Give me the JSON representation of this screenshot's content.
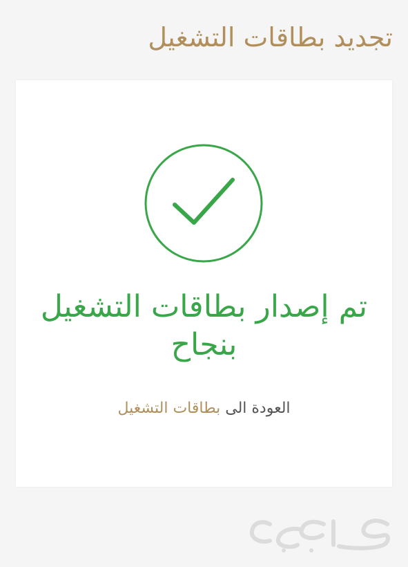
{
  "header": {
    "title": "تجديد بطاقات التشغيل"
  },
  "status": {
    "icon": "check-circle-icon",
    "message": "تم إصدار بطاقات التشغيل بنجاح",
    "color": "#3aa64a"
  },
  "return_link": {
    "prefix": "العودة الى ",
    "link_label": "بطاقات التشغيل"
  },
  "watermark": {
    "text": "حراج"
  },
  "colors": {
    "accent": "#b08f5c",
    "success": "#3aa64a",
    "background": "#f5f5f5",
    "card": "#ffffff"
  }
}
